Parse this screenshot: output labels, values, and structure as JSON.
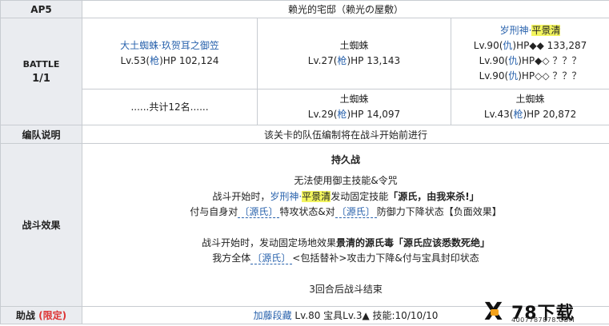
{
  "header": {
    "label": "AP5",
    "title": "赖光的宅邸（赖光の屋敷）"
  },
  "battle": {
    "label": "BATTLE",
    "count": "1/1",
    "row1": [
      {
        "name": "大土蜘蛛·玖贺耳之御笠",
        "stat_prefix": "Lv.53(",
        "class": "枪",
        "stat_suffix": ")HP 102,124"
      },
      {
        "name": "土蜘蛛",
        "stat_prefix": "Lv.27(",
        "class": "枪",
        "stat_suffix": ")HP 13,143"
      }
    ],
    "boss": {
      "name_link": "岁刑神·",
      "name_hl": "平景清",
      "lines": [
        {
          "prefix": "Lv.90(",
          "class": "仇",
          "suffix": ")HP◆◆ 133,287"
        },
        {
          "prefix": "Lv.90(",
          "class": "仇",
          "suffix": ")HP◆◇ ？？？"
        },
        {
          "prefix": "Lv.90(",
          "class": "仇",
          "suffix": ")HP◇◇ ？？？"
        }
      ]
    },
    "row2": [
      {
        "text": "......共计12名......"
      },
      {
        "name": "土蜘蛛",
        "stat_prefix": "Lv.29(",
        "class": "枪",
        "stat_suffix": ")HP 14,097"
      },
      {
        "name": "土蜘蛛",
        "stat_prefix": "Lv.43(",
        "class": "枪",
        "stat_suffix": ")HP 20,872"
      }
    ]
  },
  "formation": {
    "label": "编队说明",
    "text": "该关卡的队伍编制将在战斗开始前进行"
  },
  "effects": {
    "label": "战斗效果",
    "title": "持久战",
    "line1": "无法使用御主技能&令咒",
    "line2_a": "战斗开始时，",
    "line2_link": "岁刑神·",
    "line2_hl": "平景清",
    "line2_b": "发动固定技能",
    "line2_bold": "「源氏，由我来杀!」",
    "line3_a": "付与自身对",
    "line3_tag1": "〔源氏〕",
    "line3_b": "特攻状态&对",
    "line3_tag2": "〔源氏〕",
    "line3_c": "防御力下降状态【负面效果】",
    "line4_a": "战斗开始时，发动固定场地效果",
    "line4_bold": "景清的源氏毒「源氏应该悉数死绝」",
    "line5_a": "我方全体",
    "line5_tag": "〔源氏〕",
    "line5_b": "<包括替补>攻击力下降&付与宝具封印状态",
    "line6": "3回合后战斗结束"
  },
  "support": {
    "label_a": "助战",
    "label_b": "(限定)",
    "name": "加藤段藏",
    "info": "Lv.80 宝具Lv.3▲ 技能:10/10/10"
  },
  "watermark": {
    "big": "78下载",
    "small": "4007787878.COM"
  }
}
